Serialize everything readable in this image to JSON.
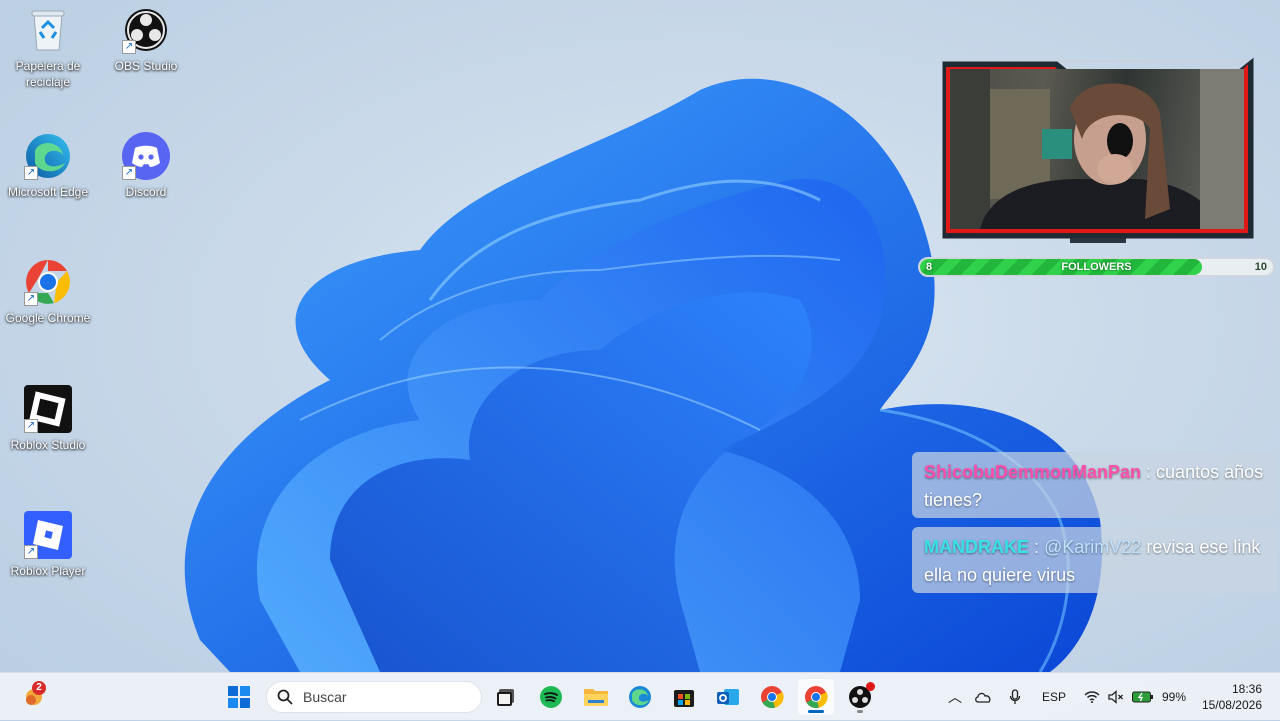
{
  "desktop": {
    "icons": [
      {
        "label": "Papelera de reciclaje",
        "icon": "recycle-bin-icon"
      },
      {
        "label": "OBS Studio",
        "icon": "obs-icon"
      },
      {
        "label": "Microsoft Edge",
        "icon": "edge-icon"
      },
      {
        "label": "Discord",
        "icon": "discord-icon"
      },
      {
        "label": "Google Chrome",
        "icon": "chrome-icon"
      },
      {
        "label": "Roblox Studio",
        "icon": "roblox-studio-icon"
      },
      {
        "label": "Roblox Player",
        "icon": "roblox-player-icon"
      }
    ]
  },
  "overlay": {
    "followers": {
      "label": "FOLLOWERS",
      "current": "8",
      "goal": "10",
      "progress": 0.8
    }
  },
  "chat": [
    {
      "user": "ShicobuDemmonManPan",
      "separator": " : ",
      "text": "cuantos años tienes?",
      "user_color": "#ff4fae"
    },
    {
      "user": "MANDRAKE",
      "separator": " : ",
      "mention": "@KarimV22",
      "text": " revisa ese link ella no quiere virus",
      "user_color": "#38e0e8"
    }
  ],
  "taskbar": {
    "weather_badge": "2",
    "search_placeholder": "Buscar",
    "pinned": [
      "start-icon",
      "task-view-icon",
      "spotify-icon",
      "file-explorer-icon",
      "edge-icon",
      "store-icon",
      "outlook-icon",
      "chrome-icon",
      "chrome-active-icon",
      "obs-icon"
    ],
    "tray": {
      "language": "ESP",
      "battery": "99%"
    },
    "clock": {
      "time": "18:36",
      "date": "15/08/2026"
    }
  },
  "colors": {
    "accent": "#0067c0",
    "followers_green": "#2fd24a",
    "cam_red": "#e01818"
  }
}
